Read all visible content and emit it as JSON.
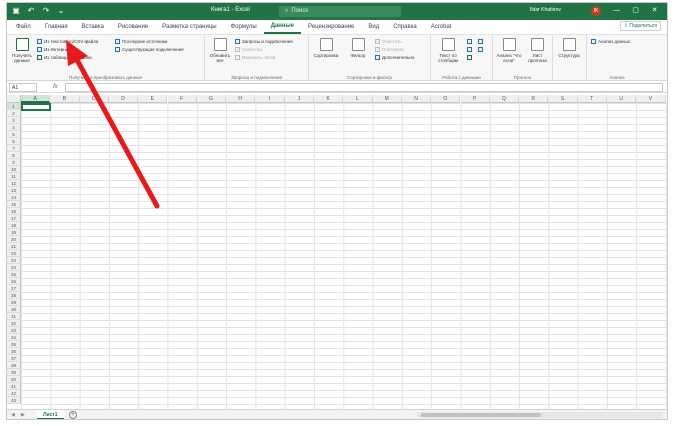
{
  "titlebar": {
    "qat": [
      "▣",
      "↶",
      "↷",
      "⌄"
    ],
    "title": "Книга1 - Excel",
    "search_placeholder": "Поиск",
    "user": "Ildar Khabirov",
    "avatar": "IK",
    "window_buttons": [
      "—",
      "▢",
      "✕"
    ]
  },
  "tabs": [
    "Файл",
    "Главная",
    "Вставка",
    "Рисование",
    "Разметка страницы",
    "Формулы",
    "Данные",
    "Рецензирование",
    "Вид",
    "Справка",
    "Acrobat"
  ],
  "active_tab": "Данные",
  "share_label": "Поделиться",
  "ribbon": {
    "get_data": {
      "big_label": "Получить данные",
      "items": [
        "Из текстового/CSV-файла",
        "Из Интернета",
        "Из таблицы/диапазона"
      ],
      "items2": [
        "Последние источники",
        "Существующие подключения"
      ],
      "group_label": "Получить и преобразовать данные"
    },
    "queries": {
      "big_label": "Обновить все",
      "items": [
        "Запросы и подключения",
        "Свойства",
        "Изменить связи"
      ],
      "group_label": "Запросы и подключения"
    },
    "sort": {
      "sort_label": "Сортировка",
      "filter_label": "Фильтр",
      "items": [
        "Очистить",
        "Повторить",
        "Дополнительно"
      ],
      "group_label": "Сортировка и фильтр"
    },
    "tools": {
      "big_label": "Текст по столбцам",
      "group_label": "Работа с данными"
    },
    "forecast": {
      "whatif_label": "Анализ \"что если\"",
      "sheet_label": "Лист прогноза",
      "group_label": "Прогноз"
    },
    "outline": {
      "label": "Структура",
      "group_label": ""
    },
    "analysis": {
      "item": "Анализ данных",
      "group_label": "Анализ"
    }
  },
  "formula_bar": {
    "name_box": "A1",
    "fx": "fx",
    "value": ""
  },
  "columns": [
    "A",
    "B",
    "C",
    "D",
    "E",
    "F",
    "G",
    "H",
    "I",
    "J",
    "K",
    "L",
    "M",
    "N",
    "O",
    "P",
    "Q",
    "R",
    "S",
    "T",
    "U",
    "V"
  ],
  "rows": [
    "1",
    "2",
    "3",
    "4",
    "5",
    "6",
    "7",
    "8",
    "9",
    "10",
    "11",
    "12",
    "13",
    "14",
    "15",
    "16",
    "17",
    "18",
    "19",
    "20",
    "21",
    "22",
    "23",
    "24",
    "25",
    "26",
    "27",
    "28",
    "29",
    "30",
    "31",
    "32",
    "33",
    "34",
    "35",
    "36",
    "37",
    "38",
    "39",
    "40",
    "41",
    "42",
    "43"
  ],
  "sheet_tab": "Лист1",
  "add_sheet": "+",
  "accent": "#217346",
  "arrow_color": "#e8191a"
}
